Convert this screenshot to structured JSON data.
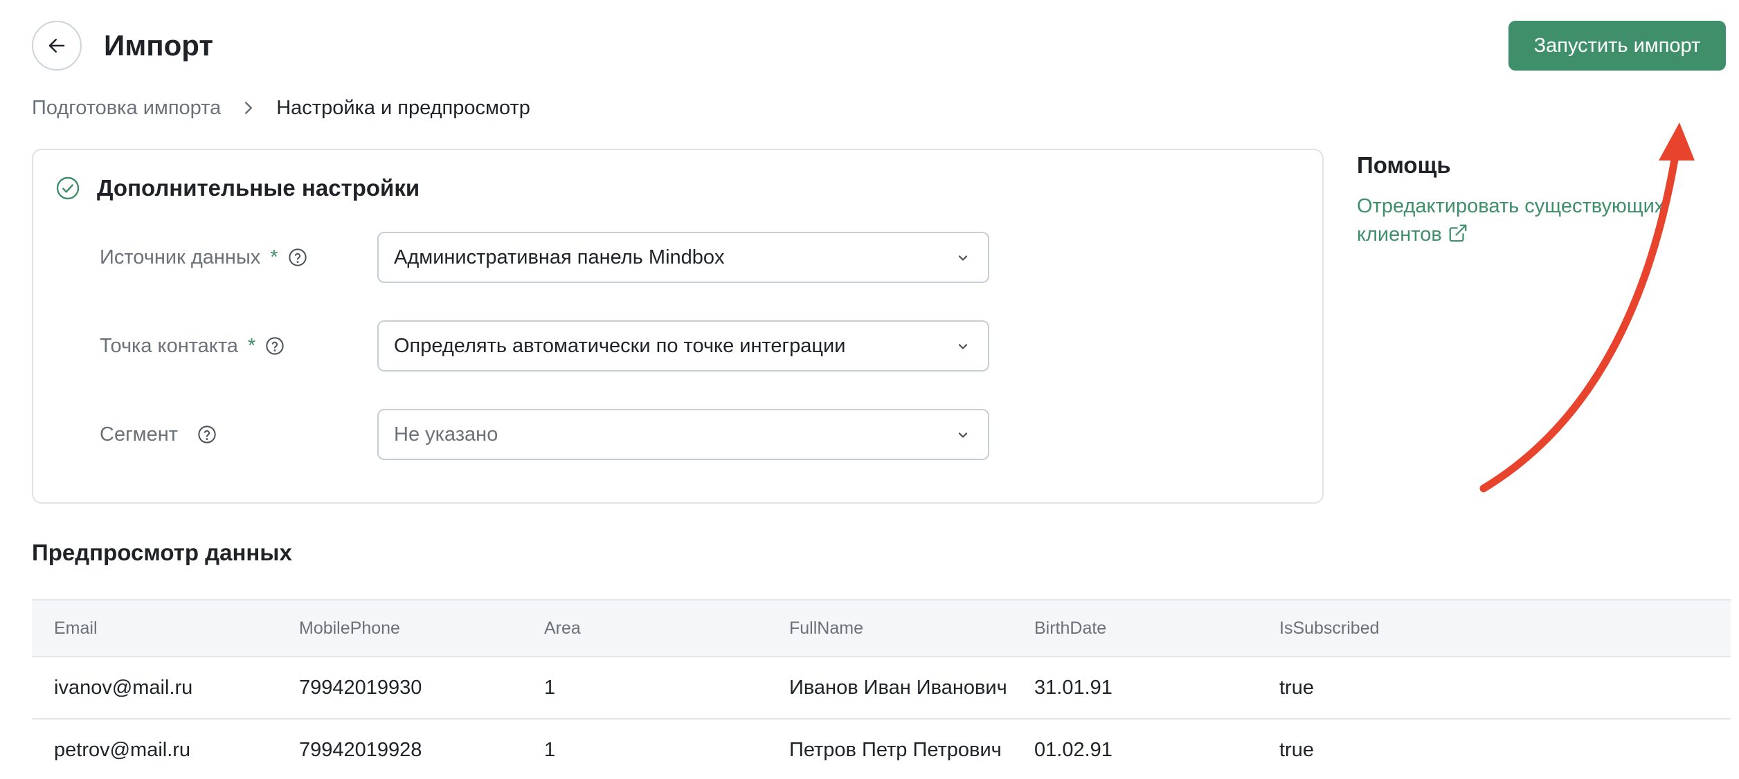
{
  "header": {
    "title": "Импорт",
    "run_button_label": "Запустить импорт"
  },
  "breadcrumb": {
    "step1": "Подготовка импорта",
    "step2": "Настройка и предпросмотр"
  },
  "settings": {
    "title": "Дополнительные настройки",
    "fields": [
      {
        "label": "Источник данных",
        "required": "*",
        "value": "Административная панель Mindbox"
      },
      {
        "label": "Точка контакта",
        "required": "*",
        "value": "Определять автоматически по точке интеграции"
      },
      {
        "label": "Сегмент",
        "required": "",
        "value": "Не указано"
      }
    ]
  },
  "help": {
    "title": "Помощь",
    "link_text": "Отредактировать существующих клиентов"
  },
  "preview": {
    "title": "Предпросмотр данных",
    "columns": [
      "Email",
      "MobilePhone",
      "Area",
      "FullName",
      "BirthDate",
      "IsSubscribed"
    ],
    "rows": [
      [
        "ivanov@mail.ru",
        "79942019930",
        "1",
        "Иванов Иван Иванович",
        "31.01.91",
        "true"
      ],
      [
        "petrov@mail.ru",
        "79942019928",
        "1",
        "Петров Петр Петрович",
        "01.02.91",
        "true"
      ]
    ]
  },
  "colors": {
    "accent": "#3f8f6b",
    "annotation_arrow": "#e8432d"
  },
  "icons": {
    "back": "arrow-left-icon",
    "breadcrumb_separator": "chevron-right-icon",
    "card_status": "check-circle-icon",
    "help": "question-circle-icon",
    "select": "chevron-down-icon",
    "external_link": "external-link-icon"
  }
}
